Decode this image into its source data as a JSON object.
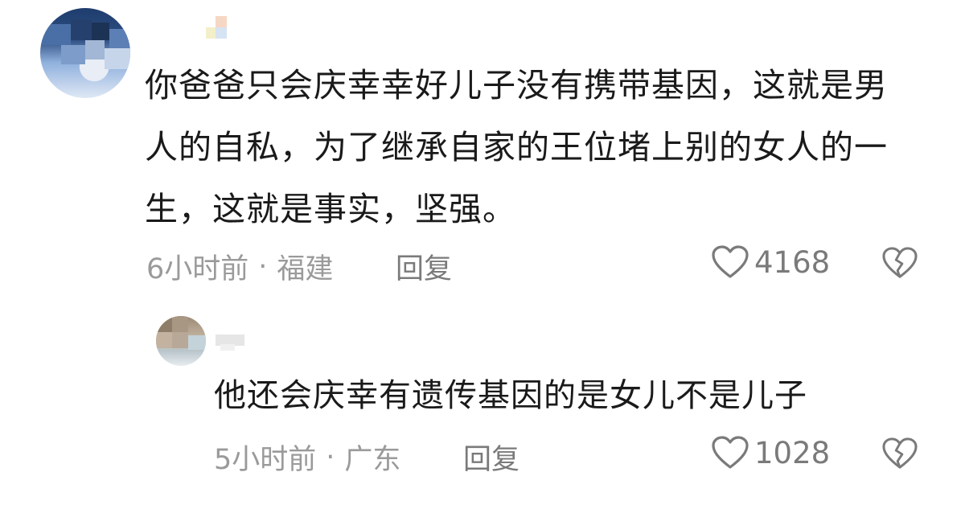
{
  "comment": {
    "text": "你爸爸只会庆幸幸好儿子没有携带基因，这就是男人的自私，为了继承自家的王位堵上别的女人的一生，这就是事实，坚强。",
    "time": "6小时前",
    "separator": "·",
    "location": "福建",
    "reply_label": "回复",
    "like_count": "4168"
  },
  "reply": {
    "text": "他还会庆幸有遗传基因的是女儿不是儿子",
    "time": "5小时前",
    "separator": "·",
    "location": "广东",
    "reply_label": "回复",
    "like_count": "1028"
  },
  "icons": {
    "like": "heart-outline-icon",
    "dislike": "broken-heart-icon"
  },
  "colors": {
    "text": "#1a1a1a",
    "meta": "#9a9a9a",
    "icon": "#7a7a7a"
  }
}
